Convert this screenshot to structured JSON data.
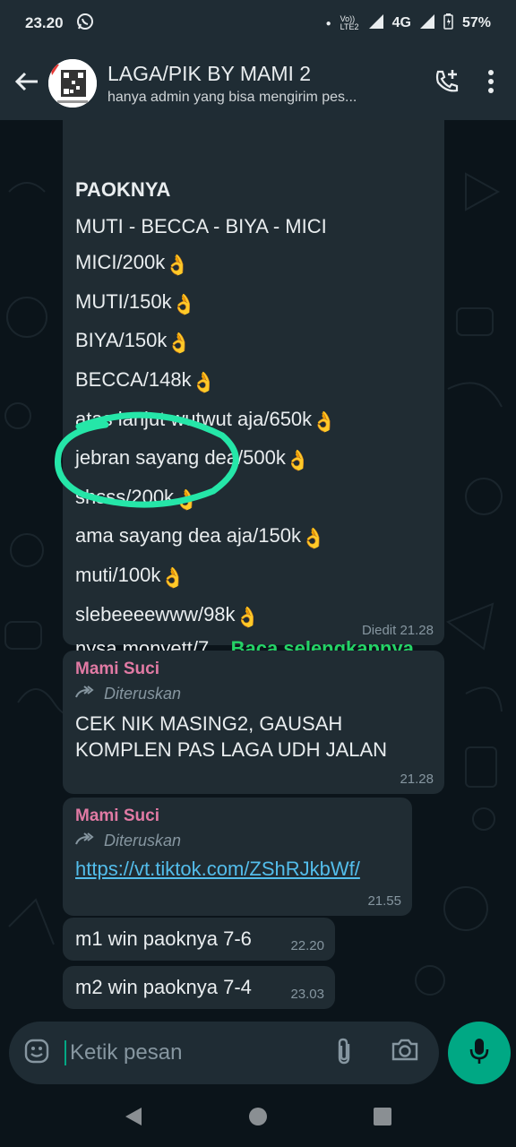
{
  "status_bar": {
    "time": "23.20",
    "network_label": "4G",
    "volte_label": "Vo)) LTE2",
    "battery": "57%"
  },
  "header": {
    "title": "LAGA/PIK BY MAMI 2",
    "subtitle": "hanya admin yang bisa mengirim pes..."
  },
  "messages": {
    "first": {
      "heading": "PAOKNYA",
      "lines": [
        "MUTI - BECCA - BIYA - MICI",
        "MICI/200k",
        "MUTI/150k",
        "BIYA/150k",
        "BECCA/148k",
        "atas lanjut wutwut aja/650k",
        "jebran sayang dea/500k",
        "shsss/200k",
        "ama sayang dea aja/150k",
        "muti/100k",
        "slebeeeewww/98k"
      ],
      "last_line": "nysa monyett/7...",
      "read_more": "Baca selengkapnya",
      "time": "Diedit 21.28"
    },
    "second": {
      "sender": "Mami Suci",
      "forwarded": "Diteruskan",
      "text_line1": "CEK NIK MASING2, GAUSAH",
      "text_line2": "KOMPLEN PAS LAGA UDH JALAN",
      "time": "21.28"
    },
    "third": {
      "sender": "Mami Suci",
      "forwarded": "Diteruskan",
      "link": "https://vt.tiktok.com/ZShRJkbWf/",
      "time": "21.55"
    },
    "fourth": {
      "text": "m1 win paoknya 7-6",
      "time": "22.20"
    },
    "fifth": {
      "text": "m2 win paoknya 7-4",
      "time": "23.03"
    }
  },
  "composer": {
    "placeholder": "Ketik pesan"
  },
  "colors": {
    "accent": "#00a884",
    "bubble": "#202c33",
    "bar": "#1f2c34",
    "link": "#53bdeb",
    "sender": "#e17aa4"
  },
  "icons": [
    "whatsapp-icon",
    "back-arrow-icon",
    "add-call-icon",
    "more-vert-icon",
    "ok-hand-emoji",
    "forward-icon",
    "emoji-icon",
    "attach-icon",
    "camera-icon",
    "mic-icon",
    "nav-back-icon",
    "nav-home-icon",
    "nav-recents-icon"
  ]
}
